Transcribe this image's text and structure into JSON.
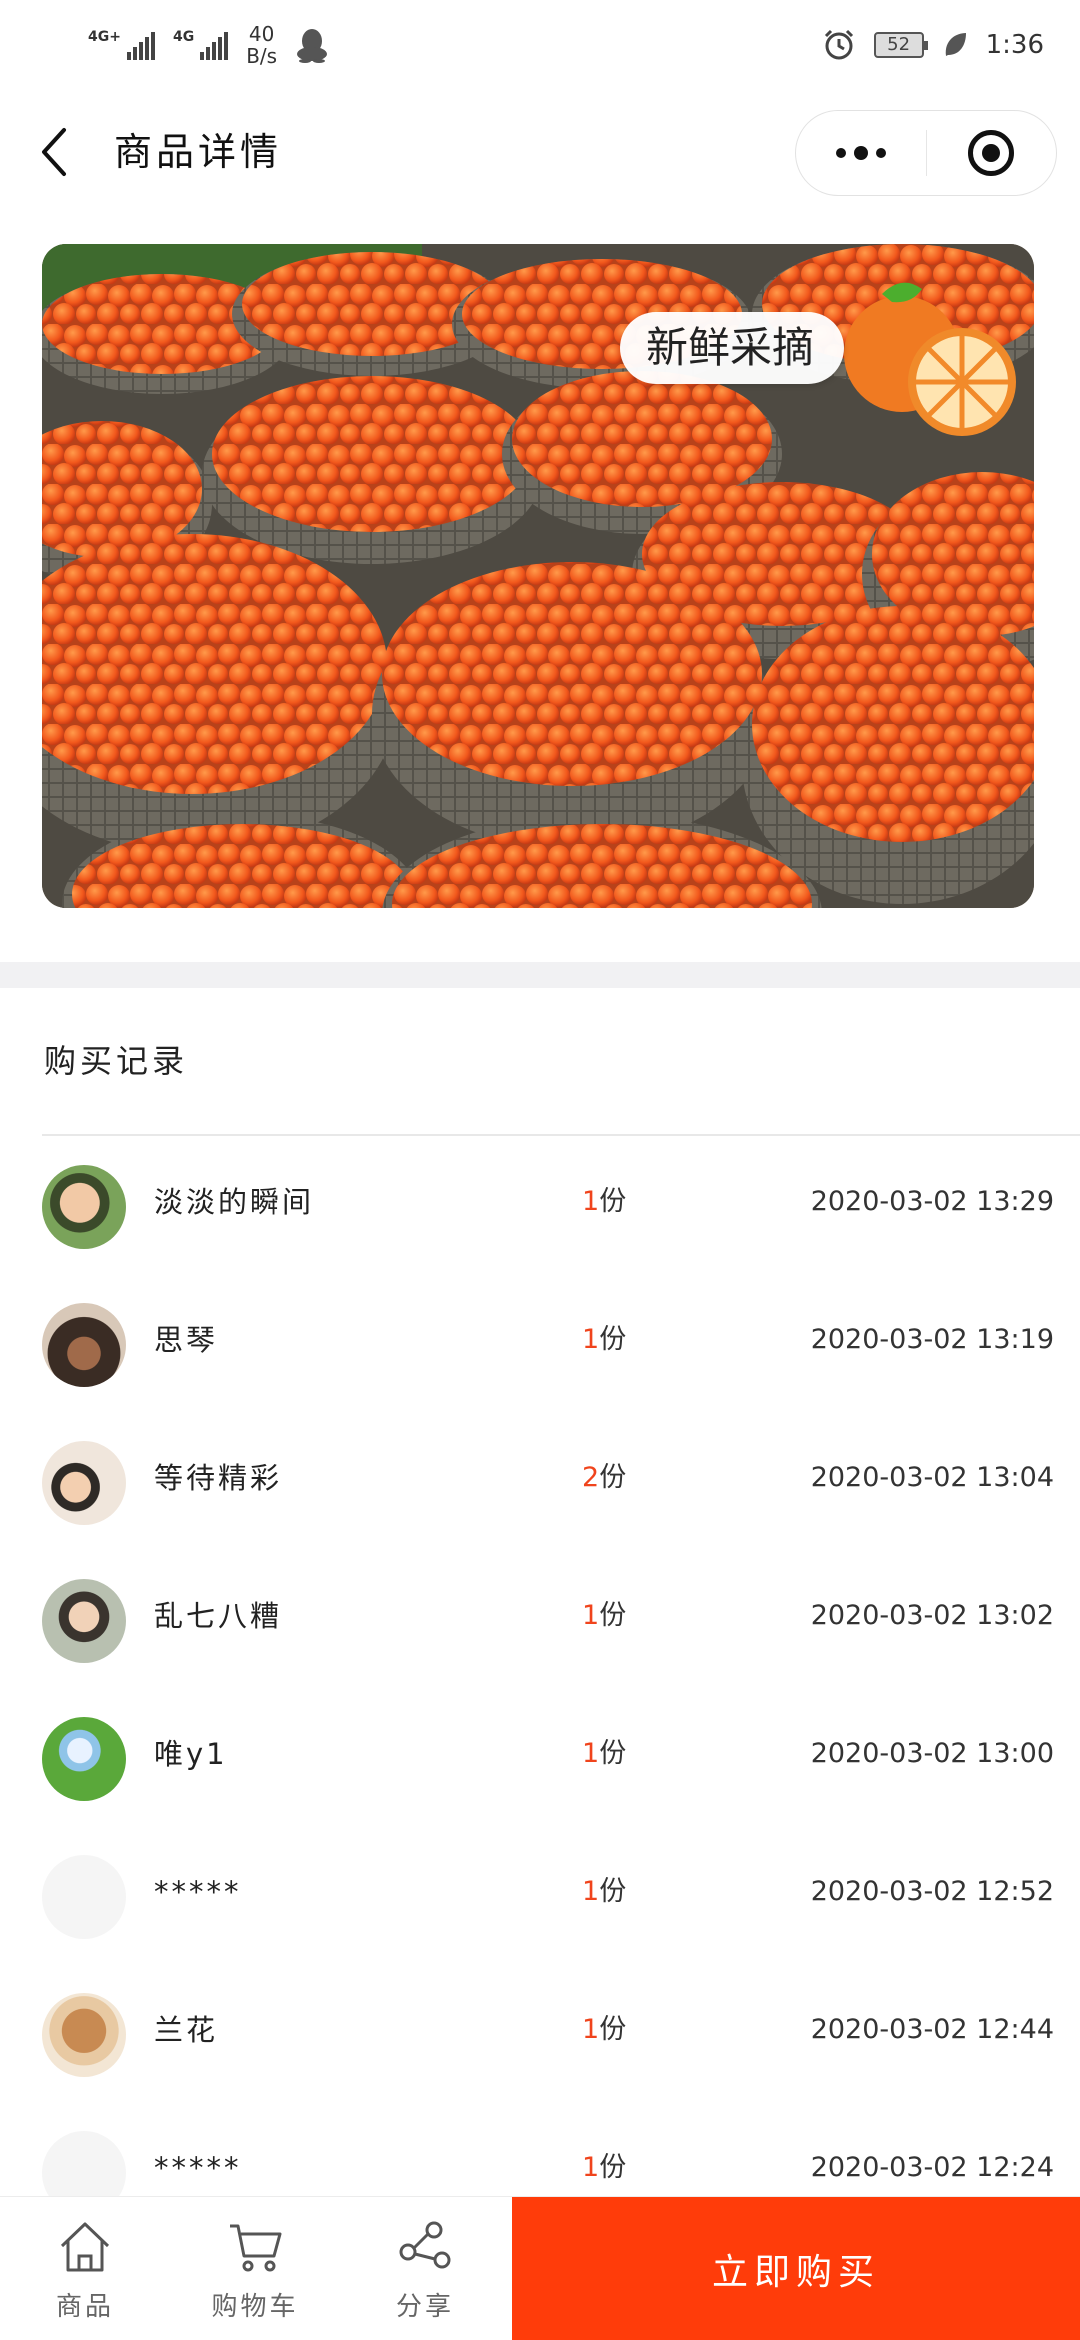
{
  "status_bar": {
    "net1": "4G+",
    "net2": "4G",
    "speed_value": "40",
    "speed_unit": "B/s",
    "battery": "52",
    "time": "1:36",
    "icons": [
      "qq-icon",
      "alarm-icon",
      "battery-icon",
      "leaf-icon"
    ]
  },
  "nav": {
    "title": "商品详情",
    "icons": [
      "back-arrow-icon",
      "more-dots-icon",
      "close-target-icon"
    ]
  },
  "banner": {
    "tag": "新鲜采摘",
    "colors": {
      "orange": "#ff7a1a",
      "basket": "#6f6a5e"
    }
  },
  "records": {
    "title": "购买记录",
    "unit": "份",
    "items": [
      {
        "name": "淡淡的瞬间",
        "qty": "1",
        "time": "2020-03-02 13:29",
        "avatar": "photo"
      },
      {
        "name": "思琴",
        "qty": "1",
        "time": "2020-03-02 13:19",
        "avatar": "photo"
      },
      {
        "name": "等待精彩",
        "qty": "2",
        "time": "2020-03-02 13:04",
        "avatar": "photo"
      },
      {
        "name": "乱七八糟",
        "qty": "1",
        "time": "2020-03-02 13:02",
        "avatar": "photo"
      },
      {
        "name": "唯y1",
        "qty": "1",
        "time": "2020-03-02 13:00",
        "avatar": "photo"
      },
      {
        "name": "*****",
        "qty": "1",
        "time": "2020-03-02 12:52",
        "avatar": "blank"
      },
      {
        "name": "兰花",
        "qty": "1",
        "time": "2020-03-02 12:44",
        "avatar": "photo"
      },
      {
        "name": "*****",
        "qty": "1",
        "time": "2020-03-02 12:24",
        "avatar": "blank"
      }
    ]
  },
  "bottom_bar": {
    "tabs": [
      {
        "label": "商品",
        "icon": "home-icon"
      },
      {
        "label": "购物车",
        "icon": "cart-icon"
      },
      {
        "label": "分享",
        "icon": "share-icon"
      }
    ],
    "buy_label": "立即购买",
    "buy_color": "#ff3c0a"
  }
}
